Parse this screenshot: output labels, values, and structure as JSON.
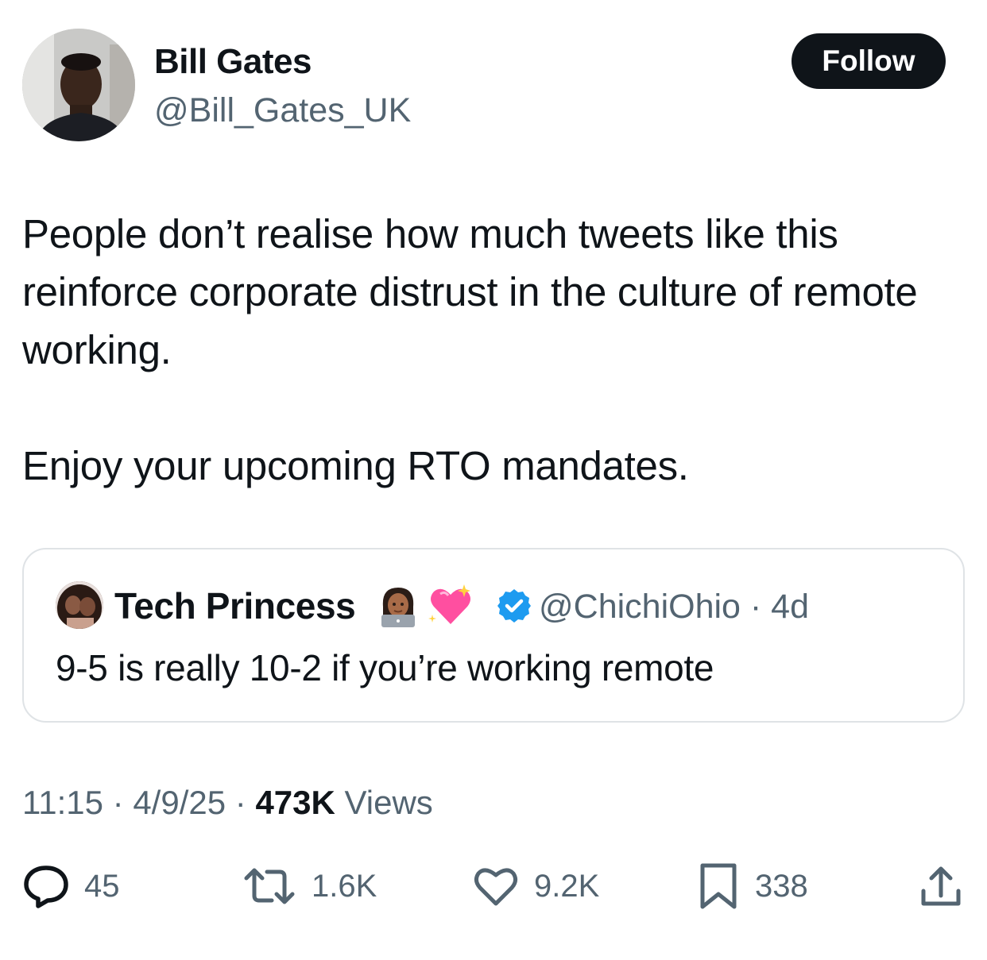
{
  "author": {
    "name": "Bill Gates",
    "handle": "@Bill_Gates_UK",
    "follow_label": "Follow"
  },
  "tweet": {
    "paragraphs": [
      "People don’t realise how much tweets like this reinforce corporate distrust in the culture of remote working.",
      "Enjoy your upcoming RTO mandates."
    ]
  },
  "quoted_tweet": {
    "name": "Tech Princess",
    "handle_time": "@ChichiOhio · 4d",
    "text": "9-5 is really 10-2 if you’re working remote",
    "verified": true
  },
  "meta": {
    "time": "11:15",
    "sep1": " · ",
    "date": "4/9/25",
    "sep2": " · ",
    "views_count": "473K",
    "views_label": " Views"
  },
  "actions": {
    "replies": "45",
    "reposts": "1.6K",
    "likes": "9.2K",
    "bookmarks": "338"
  },
  "colors": {
    "text": "#0f1419",
    "secondary": "#536471",
    "border": "#dfe3e6",
    "verified": "#1d9bf0",
    "button_bg": "#0f1419"
  }
}
